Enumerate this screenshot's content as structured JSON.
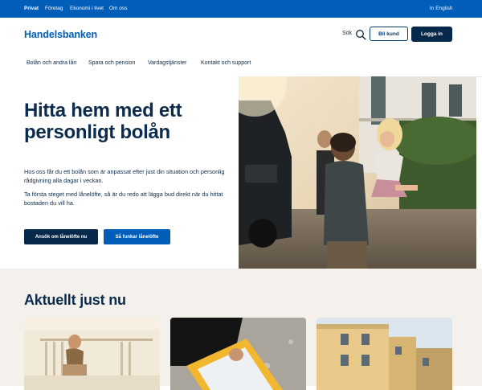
{
  "topbar": {
    "links": [
      "Privat",
      "Företag",
      "Ekonomi i livet",
      "Om oss"
    ],
    "english": "In English"
  },
  "header": {
    "logo": "Handelsbanken",
    "search_label": "Sök",
    "become_customer": "Bli kund",
    "login": "Logga in"
  },
  "nav": {
    "items": [
      "Bolån och andra lån",
      "Spara och pension",
      "Vardagstjänster",
      "Kontakt och support"
    ]
  },
  "hero": {
    "title": "Hitta hem med ett personligt bolån",
    "paragraph1": "Hos oss får du ett bolån som är anpassat efter just din situation och personlig rådgivning alla dagar i veckan.",
    "paragraph2": "Ta första steget med lånelöfte, så är du redo att lägga bud direkt när du hittat bostaden du vill ha.",
    "cta_primary": "Ansök om lånelöfte nu",
    "cta_secondary": "Så funkar lånelöfte"
  },
  "news": {
    "title": "Aktuellt just nu"
  },
  "colors": {
    "brand_blue": "#005eb8",
    "navy": "#06284a",
    "beige": "#f4f1ec"
  }
}
